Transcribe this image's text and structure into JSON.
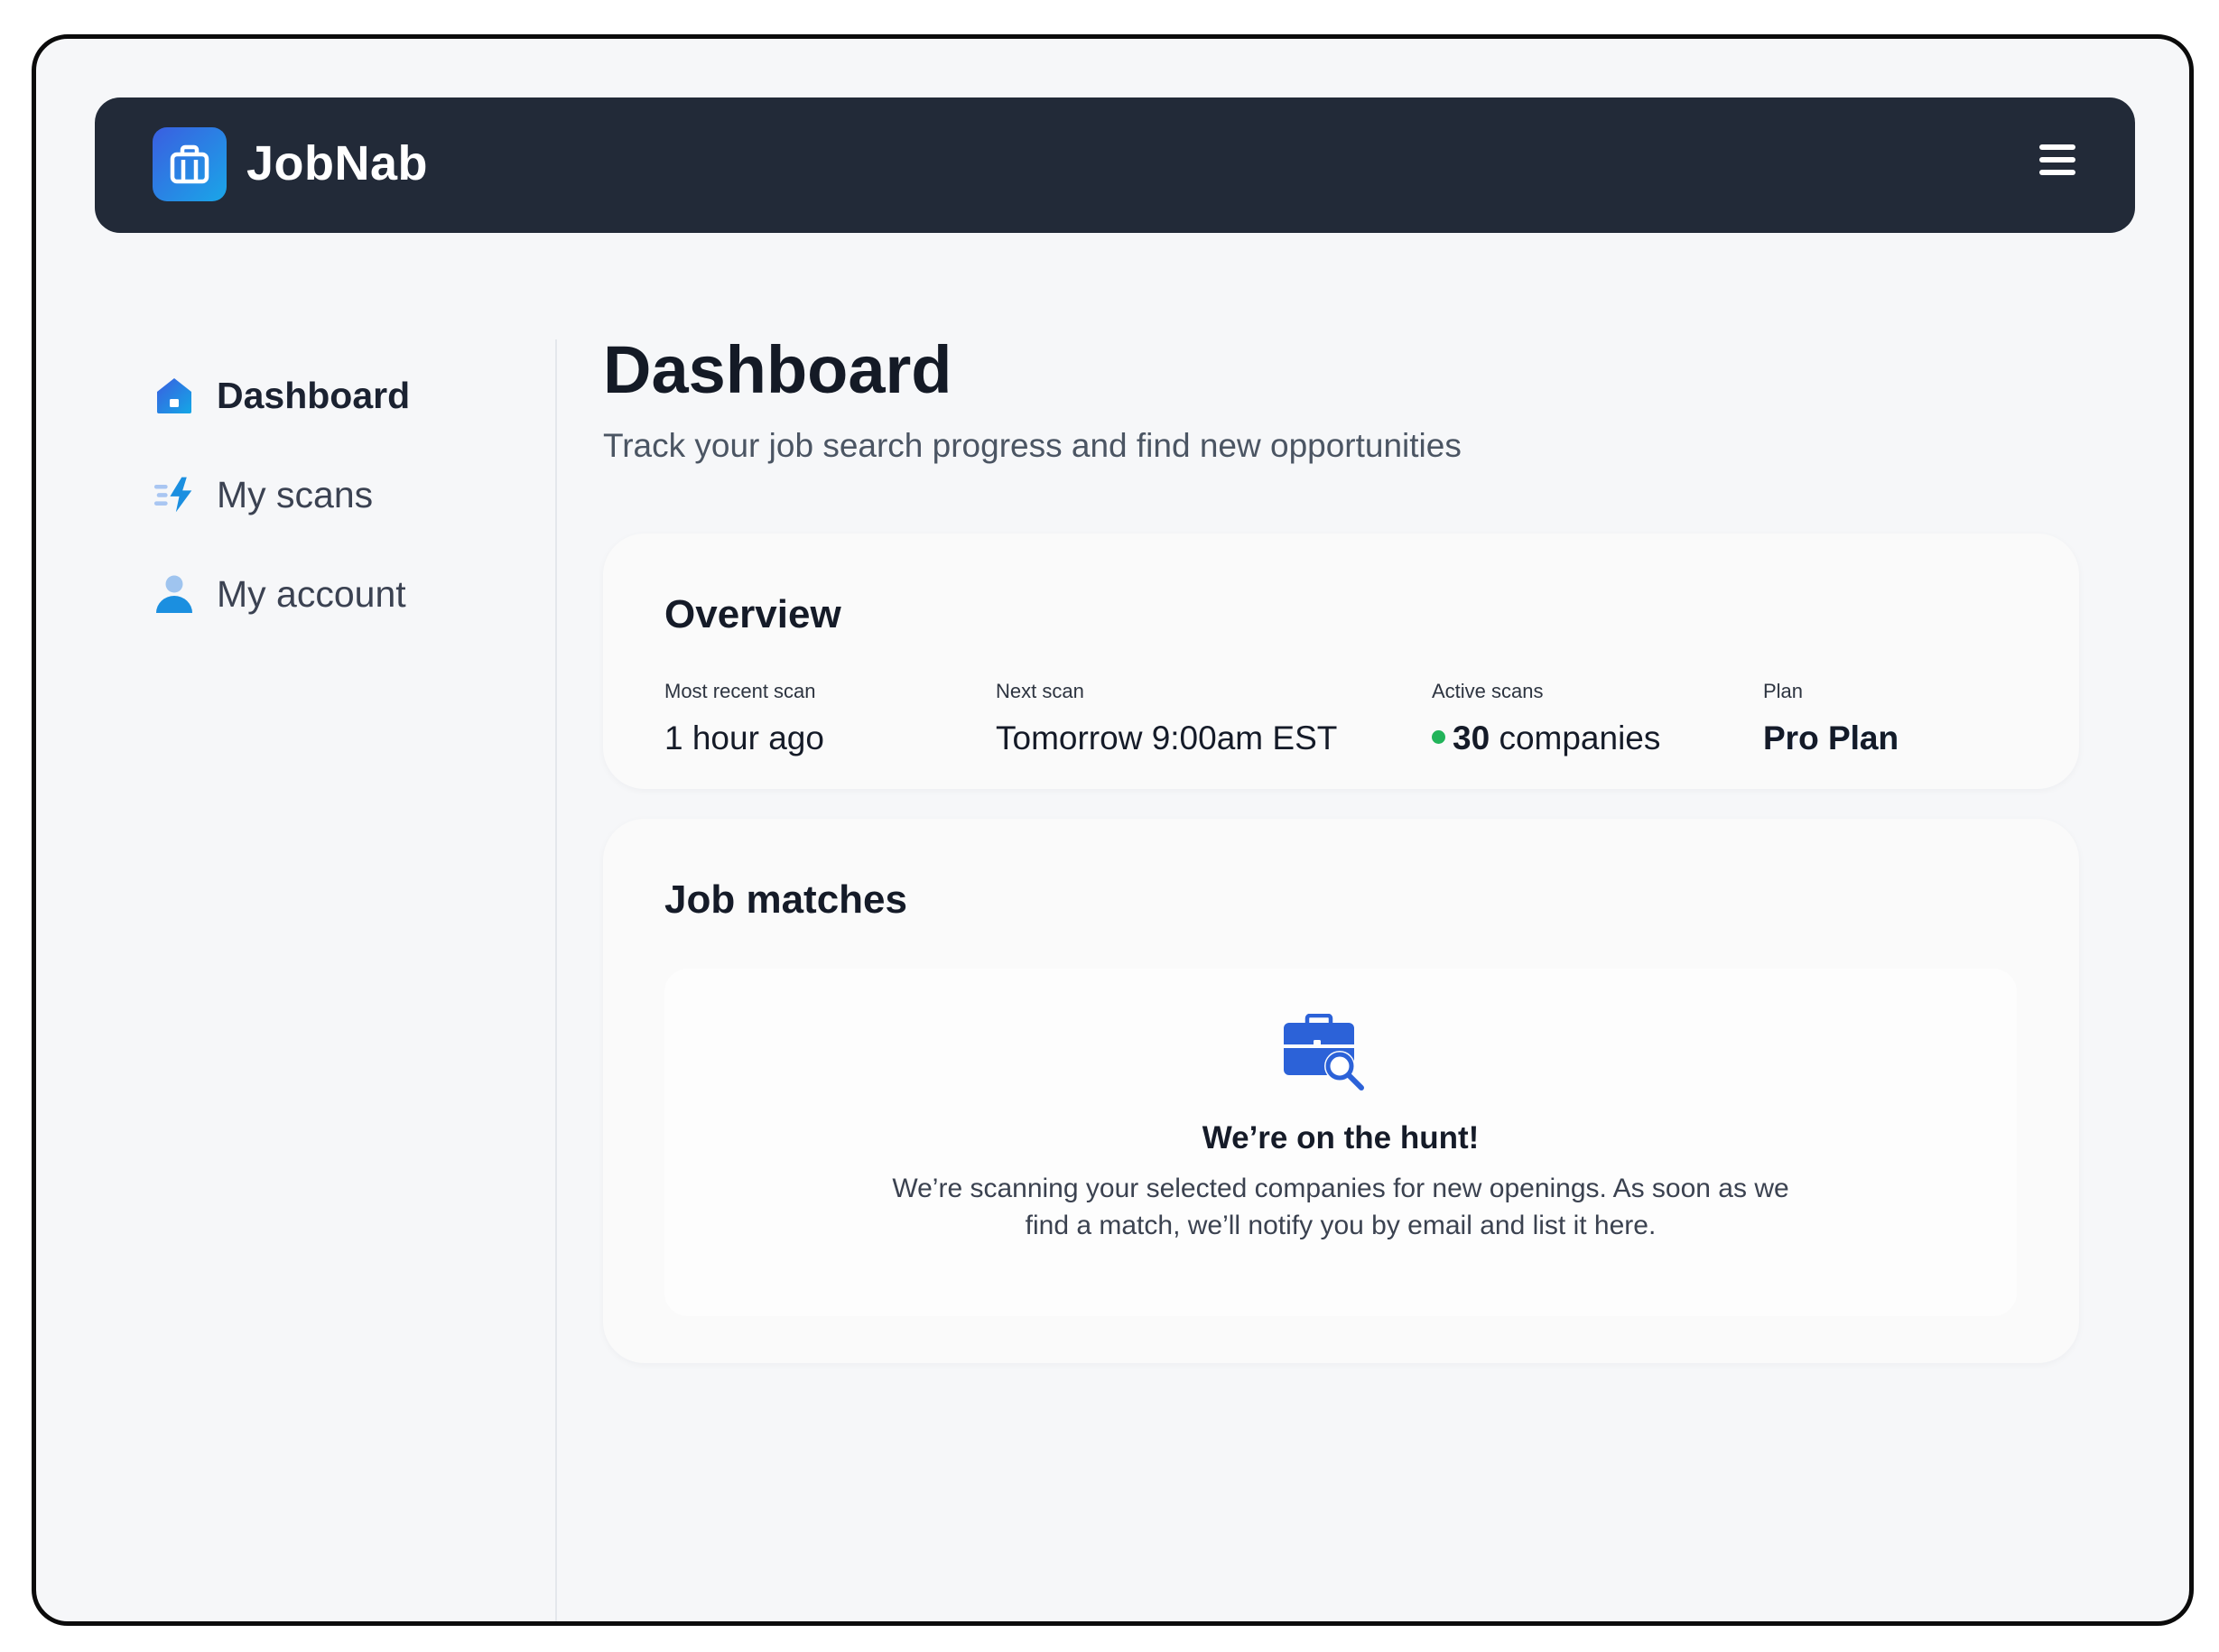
{
  "header": {
    "brand": "JobNab",
    "logo_icon": "briefcase-icon",
    "menu_icon": "hamburger-menu-icon"
  },
  "sidebar": {
    "items": [
      {
        "label": "Dashboard",
        "icon": "home-icon",
        "active": true
      },
      {
        "label": "My scans",
        "icon": "lightning-scan-icon",
        "active": false
      },
      {
        "label": "My account",
        "icon": "user-icon",
        "active": false
      }
    ]
  },
  "main": {
    "title": "Dashboard",
    "subtitle": "Track your job search progress and find new opportunities",
    "overview": {
      "title": "Overview",
      "stats": [
        {
          "label": "Most recent scan",
          "value": "1 hour ago"
        },
        {
          "label": "Next scan",
          "value": "Tomorrow 9:00am EST"
        },
        {
          "label": "Active scans",
          "count": "30",
          "unit": "companies",
          "status_color": "#22b45a"
        },
        {
          "label": "Plan",
          "value": "Pro Plan"
        }
      ]
    },
    "job_matches": {
      "title": "Job matches",
      "empty_icon": "briefcase-search-icon",
      "empty_title": "We’re on the hunt!",
      "empty_text": "We’re scanning your selected companies for new openings. As soon as we find a match, we’ll notify you by email and list it here."
    }
  },
  "colors": {
    "header_bg": "#222a38",
    "accent_blue": "#3a5ee0",
    "accent_cyan": "#139fd6",
    "status_green": "#22b45a"
  }
}
